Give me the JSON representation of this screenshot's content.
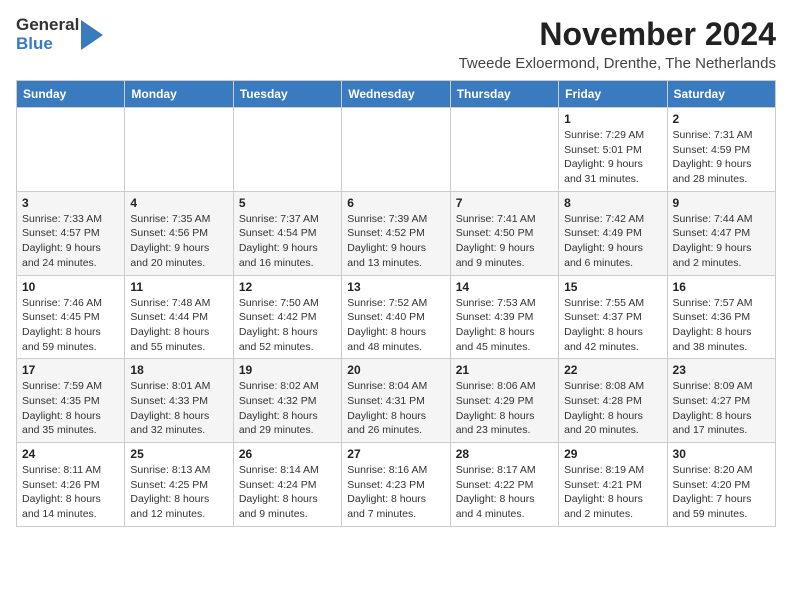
{
  "header": {
    "logo_general": "General",
    "logo_blue": "Blue",
    "month_title": "November 2024",
    "subtitle": "Tweede Exloermond, Drenthe, The Netherlands"
  },
  "weekdays": [
    "Sunday",
    "Monday",
    "Tuesday",
    "Wednesday",
    "Thursday",
    "Friday",
    "Saturday"
  ],
  "weeks": [
    {
      "days": [
        {
          "num": "",
          "info": ""
        },
        {
          "num": "",
          "info": ""
        },
        {
          "num": "",
          "info": ""
        },
        {
          "num": "",
          "info": ""
        },
        {
          "num": "",
          "info": ""
        },
        {
          "num": "1",
          "info": "Sunrise: 7:29 AM\nSunset: 5:01 PM\nDaylight: 9 hours and 31 minutes."
        },
        {
          "num": "2",
          "info": "Sunrise: 7:31 AM\nSunset: 4:59 PM\nDaylight: 9 hours and 28 minutes."
        }
      ]
    },
    {
      "days": [
        {
          "num": "3",
          "info": "Sunrise: 7:33 AM\nSunset: 4:57 PM\nDaylight: 9 hours and 24 minutes."
        },
        {
          "num": "4",
          "info": "Sunrise: 7:35 AM\nSunset: 4:56 PM\nDaylight: 9 hours and 20 minutes."
        },
        {
          "num": "5",
          "info": "Sunrise: 7:37 AM\nSunset: 4:54 PM\nDaylight: 9 hours and 16 minutes."
        },
        {
          "num": "6",
          "info": "Sunrise: 7:39 AM\nSunset: 4:52 PM\nDaylight: 9 hours and 13 minutes."
        },
        {
          "num": "7",
          "info": "Sunrise: 7:41 AM\nSunset: 4:50 PM\nDaylight: 9 hours and 9 minutes."
        },
        {
          "num": "8",
          "info": "Sunrise: 7:42 AM\nSunset: 4:49 PM\nDaylight: 9 hours and 6 minutes."
        },
        {
          "num": "9",
          "info": "Sunrise: 7:44 AM\nSunset: 4:47 PM\nDaylight: 9 hours and 2 minutes."
        }
      ]
    },
    {
      "days": [
        {
          "num": "10",
          "info": "Sunrise: 7:46 AM\nSunset: 4:45 PM\nDaylight: 8 hours and 59 minutes."
        },
        {
          "num": "11",
          "info": "Sunrise: 7:48 AM\nSunset: 4:44 PM\nDaylight: 8 hours and 55 minutes."
        },
        {
          "num": "12",
          "info": "Sunrise: 7:50 AM\nSunset: 4:42 PM\nDaylight: 8 hours and 52 minutes."
        },
        {
          "num": "13",
          "info": "Sunrise: 7:52 AM\nSunset: 4:40 PM\nDaylight: 8 hours and 48 minutes."
        },
        {
          "num": "14",
          "info": "Sunrise: 7:53 AM\nSunset: 4:39 PM\nDaylight: 8 hours and 45 minutes."
        },
        {
          "num": "15",
          "info": "Sunrise: 7:55 AM\nSunset: 4:37 PM\nDaylight: 8 hours and 42 minutes."
        },
        {
          "num": "16",
          "info": "Sunrise: 7:57 AM\nSunset: 4:36 PM\nDaylight: 8 hours and 38 minutes."
        }
      ]
    },
    {
      "days": [
        {
          "num": "17",
          "info": "Sunrise: 7:59 AM\nSunset: 4:35 PM\nDaylight: 8 hours and 35 minutes."
        },
        {
          "num": "18",
          "info": "Sunrise: 8:01 AM\nSunset: 4:33 PM\nDaylight: 8 hours and 32 minutes."
        },
        {
          "num": "19",
          "info": "Sunrise: 8:02 AM\nSunset: 4:32 PM\nDaylight: 8 hours and 29 minutes."
        },
        {
          "num": "20",
          "info": "Sunrise: 8:04 AM\nSunset: 4:31 PM\nDaylight: 8 hours and 26 minutes."
        },
        {
          "num": "21",
          "info": "Sunrise: 8:06 AM\nSunset: 4:29 PM\nDaylight: 8 hours and 23 minutes."
        },
        {
          "num": "22",
          "info": "Sunrise: 8:08 AM\nSunset: 4:28 PM\nDaylight: 8 hours and 20 minutes."
        },
        {
          "num": "23",
          "info": "Sunrise: 8:09 AM\nSunset: 4:27 PM\nDaylight: 8 hours and 17 minutes."
        }
      ]
    },
    {
      "days": [
        {
          "num": "24",
          "info": "Sunrise: 8:11 AM\nSunset: 4:26 PM\nDaylight: 8 hours and 14 minutes."
        },
        {
          "num": "25",
          "info": "Sunrise: 8:13 AM\nSunset: 4:25 PM\nDaylight: 8 hours and 12 minutes."
        },
        {
          "num": "26",
          "info": "Sunrise: 8:14 AM\nSunset: 4:24 PM\nDaylight: 8 hours and 9 minutes."
        },
        {
          "num": "27",
          "info": "Sunrise: 8:16 AM\nSunset: 4:23 PM\nDaylight: 8 hours and 7 minutes."
        },
        {
          "num": "28",
          "info": "Sunrise: 8:17 AM\nSunset: 4:22 PM\nDaylight: 8 hours and 4 minutes."
        },
        {
          "num": "29",
          "info": "Sunrise: 8:19 AM\nSunset: 4:21 PM\nDaylight: 8 hours and 2 minutes."
        },
        {
          "num": "30",
          "info": "Sunrise: 8:20 AM\nSunset: 4:20 PM\nDaylight: 7 hours and 59 minutes."
        }
      ]
    }
  ]
}
